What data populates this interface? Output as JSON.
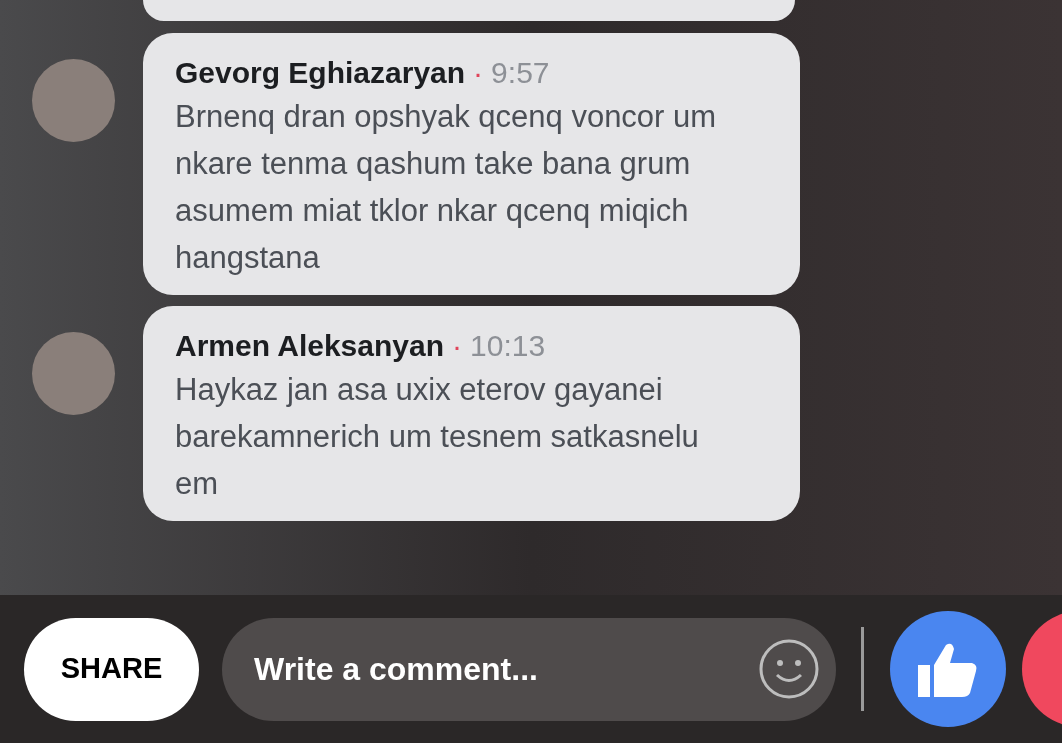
{
  "comments": [
    {
      "author": "Gevorg Eghiazaryan",
      "separator": "·",
      "time": "9:57",
      "text": "Brnenq dran opshyak qcenq voncor um nkare tenma qashum take bana grum asumem miat tklor nkar qcenq miqich hangstana"
    },
    {
      "author": "Armen Aleksanyan",
      "separator": "·",
      "time": "10:13",
      "text": "Haykaz jan asa uxix eterov gayanei barekamnerich um tesnem satkasnelu em"
    }
  ],
  "share_button": "SHARE",
  "comment_field": {
    "placeholder": "Write a comment..."
  }
}
